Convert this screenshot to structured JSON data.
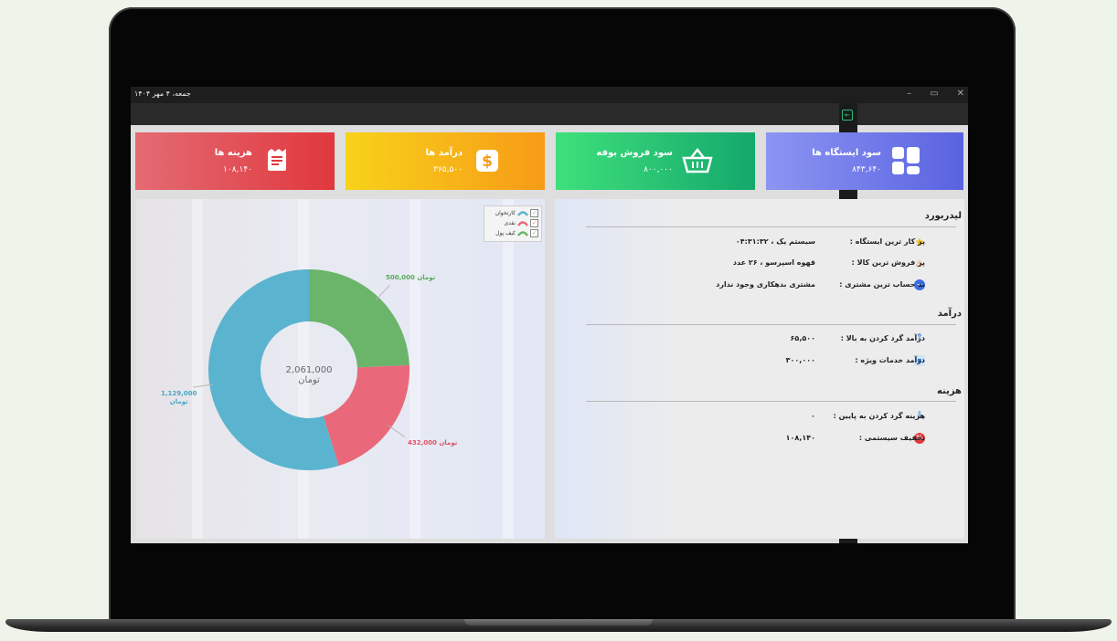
{
  "window": {
    "date": "جمعه، ۴ مهر ۱۴۰۴",
    "controls": [
      "–",
      "▭",
      "✕"
    ]
  },
  "cards": [
    {
      "title": "هزینه ها",
      "value": "۱۰۸,۱۴۰",
      "icon": "receipt-icon"
    },
    {
      "title": "درآمد ها",
      "value": "۳۶۵,۵۰۰",
      "icon": "dollar-icon"
    },
    {
      "title": "سود فروش بوفه",
      "value": "۸۰۰,۰۰۰",
      "icon": "basket-icon"
    },
    {
      "title": "سود ایستگاه ها",
      "value": "۸۴۳,۶۴۰",
      "icon": "grid-icon"
    }
  ],
  "legend": {
    "items": [
      "کارتخوان",
      "نقدی",
      "کیف پول"
    ],
    "colors": [
      "#5bb4cf",
      "#e9697b",
      "#6ab56a"
    ]
  },
  "chart_data": {
    "type": "pie",
    "center_label": "2,061,000 تومان",
    "series": [
      {
        "name": "کیف پول",
        "value": 500000,
        "label": "500,000",
        "unit": "تومان",
        "color": "#6ab56a"
      },
      {
        "name": "نقدی",
        "value": 432000,
        "label": "432,000",
        "unit": "تومان",
        "color": "#e9697b"
      },
      {
        "name": "کارتخوان",
        "value": 1129000,
        "label": "1,129,000",
        "unit": "تومان",
        "color": "#5bb4cf"
      }
    ]
  },
  "leaderboard": {
    "title": "لیدربورد",
    "rows": [
      {
        "label": "پر کار ترین ایستگاه :",
        "value": "سیستم یک ، ۰۴:۳۱:۳۲"
      },
      {
        "label": "پر فروش ترین کالا :",
        "value": "قهوه اسپرسو ، ۲۶ عدد"
      },
      {
        "label": "بد حساب ترین مشتری :",
        "value": "مشتری بدهکاری وجود ندارد"
      }
    ]
  },
  "income": {
    "title": "درآمد",
    "rows": [
      {
        "label": "درآمد گرد کردن به بالا :",
        "value": "۶۵,۵۰۰"
      },
      {
        "label": "درآمد خدمات ویژه :",
        "value": "۳۰۰,۰۰۰"
      }
    ]
  },
  "expense": {
    "title": "هزینه",
    "rows": [
      {
        "label": "هزینه گرد کردن به پایین :",
        "value": "۰"
      },
      {
        "label": "تخفیف سیستمی :",
        "value": "۱۰۸,۱۴۰"
      }
    ]
  },
  "sidebar": [
    "chat-icon",
    "timer-icon",
    "card-icon",
    "users-icon",
    "box-icon",
    "apps-icon",
    "user-settings-icon",
    "wallet-icon",
    "money-bag-icon",
    "list-icon",
    "pie-chart-icon",
    "settings-icon"
  ],
  "colors": {
    "accent": "#27c07e"
  }
}
